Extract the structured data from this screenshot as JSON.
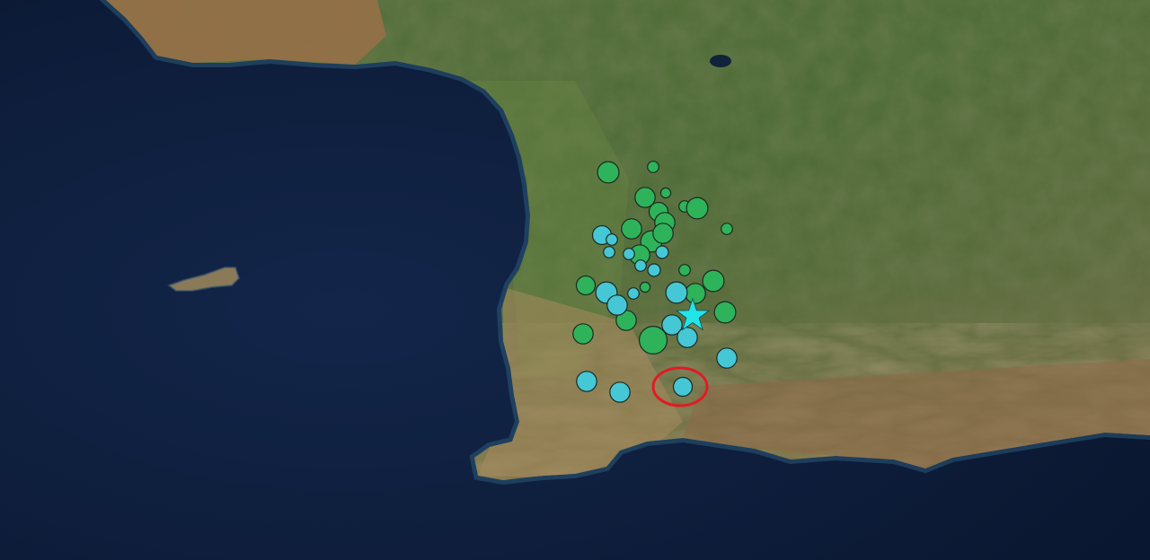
{
  "map": {
    "basemap": "satellite-imagery",
    "colors": {
      "sea": "#0f1f3d",
      "sea_deep": "#0a1730",
      "land_green": "#4e6b34",
      "land_dark_green": "#33502a",
      "land_brown": "#8a6a44",
      "land_tan": "#a58358",
      "coast_sand": "#b39468"
    }
  },
  "legend_colors": {
    "older_events": "#2fb35a",
    "recent_events": "#45c7d6",
    "mainshock": "#22e5ea",
    "selection_ring": "#e01b24",
    "marker_outline": "#1a2a22"
  },
  "events": [
    {
      "id": "e1",
      "category": "older",
      "magnitude": 3.0
    },
    {
      "id": "e2",
      "category": "older",
      "magnitude": 2.2
    },
    {
      "id": "e3",
      "category": "older",
      "magnitude": 2.9
    },
    {
      "id": "e4",
      "category": "older",
      "magnitude": 2.1
    },
    {
      "id": "e5",
      "category": "older",
      "magnitude": 2.8
    },
    {
      "id": "e6",
      "category": "older",
      "magnitude": 2.2
    },
    {
      "id": "e7",
      "category": "older",
      "magnitude": 3.0
    },
    {
      "id": "e8",
      "category": "older",
      "magnitude": 2.9
    },
    {
      "id": "e9",
      "category": "older",
      "magnitude": 2.9
    },
    {
      "id": "e10",
      "category": "older",
      "magnitude": 3.0
    },
    {
      "id": "e11",
      "category": "older",
      "magnitude": 2.2
    },
    {
      "id": "e12",
      "category": "older",
      "magnitude": 2.9
    },
    {
      "id": "e13",
      "category": "older",
      "magnitude": 2.9
    },
    {
      "id": "e14",
      "category": "older",
      "magnitude": 2.2
    },
    {
      "id": "e15",
      "category": "older",
      "magnitude": 3.0
    },
    {
      "id": "e16",
      "category": "older",
      "magnitude": 2.8
    },
    {
      "id": "e17",
      "category": "older",
      "magnitude": 2.9
    },
    {
      "id": "e18",
      "category": "older",
      "magnitude": 2.9
    },
    {
      "id": "e19",
      "category": "older",
      "magnitude": 3.5
    },
    {
      "id": "e20",
      "category": "older",
      "magnitude": 2.9
    },
    {
      "id": "e21",
      "category": "older",
      "magnitude": 2.1
    },
    {
      "id": "e22",
      "category": "older",
      "magnitude": 3.0
    },
    {
      "id": "r1",
      "category": "recent",
      "magnitude": 2.8
    },
    {
      "id": "r2",
      "category": "recent",
      "magnitude": 2.2
    },
    {
      "id": "r3",
      "category": "recent",
      "magnitude": 2.2
    },
    {
      "id": "r4",
      "category": "recent",
      "magnitude": 2.2
    },
    {
      "id": "r5",
      "category": "recent",
      "magnitude": 2.3
    },
    {
      "id": "r6",
      "category": "recent",
      "magnitude": 2.2
    },
    {
      "id": "r7",
      "category": "recent",
      "magnitude": 3.0
    },
    {
      "id": "r8",
      "category": "recent",
      "magnitude": 2.3
    },
    {
      "id": "r9",
      "category": "recent",
      "magnitude": 2.2
    },
    {
      "id": "r10",
      "category": "recent",
      "magnitude": 3.0
    },
    {
      "id": "r11",
      "category": "recent",
      "magnitude": 2.9
    },
    {
      "id": "r12",
      "category": "recent",
      "magnitude": 2.9
    },
    {
      "id": "r13",
      "category": "recent",
      "magnitude": 2.9
    },
    {
      "id": "r14",
      "category": "recent",
      "magnitude": 2.9
    },
    {
      "id": "r15",
      "category": "recent",
      "magnitude": 2.9
    },
    {
      "id": "r16",
      "category": "recent",
      "magnitude": 2.9
    },
    {
      "id": "r17",
      "category": "recent",
      "magnitude": 2.8,
      "selected": true
    }
  ],
  "mainshock": {
    "id": "m1",
    "symbol": "star-icon"
  }
}
